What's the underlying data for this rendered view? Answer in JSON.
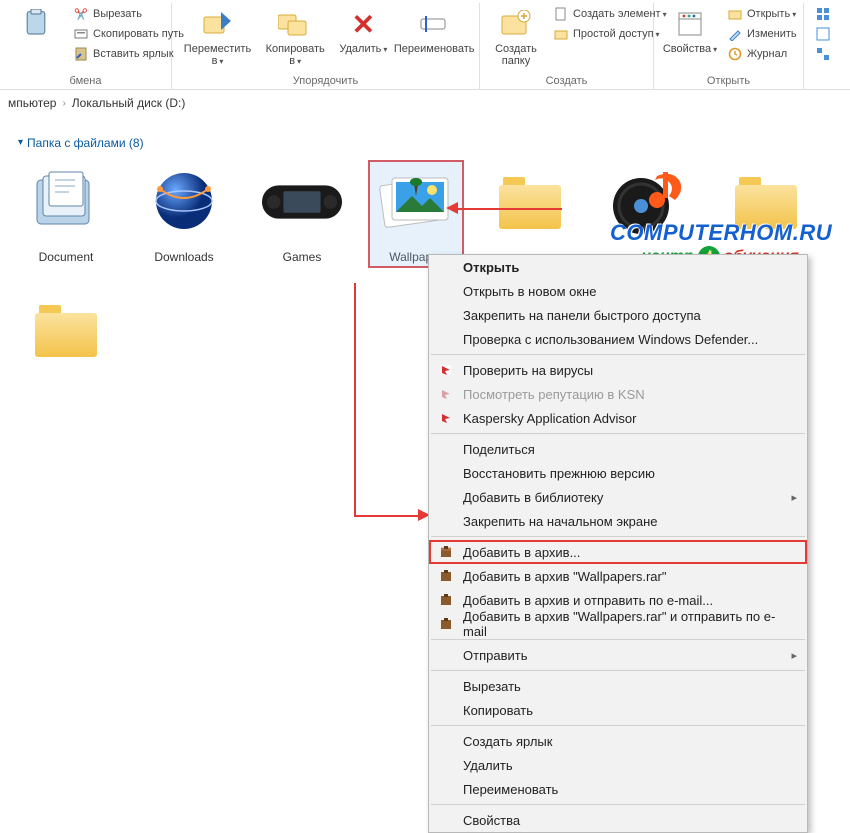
{
  "ribbon": {
    "group_clipboard": {
      "pin": "",
      "cut": "Вырезать",
      "copy_path": "Скопировать путь",
      "paste_shortcut": "Вставить ярлык",
      "label": "бмена"
    },
    "group_organize": {
      "move_to": "Переместить в",
      "copy_to": "Копировать в",
      "delete": "Удалить",
      "rename": "Переименовать",
      "label": "Упорядочить"
    },
    "group_create": {
      "new_folder": "Создать папку",
      "new_item": "Создать элемент",
      "easy_access": "Простой доступ",
      "label": "Создать"
    },
    "group_open": {
      "properties": "Свойства",
      "open": "Открыть",
      "edit": "Изменить",
      "history": "Журнал",
      "label": "Открыть"
    }
  },
  "breadcrumb": {
    "a": "мпьютер",
    "b": "Локальный диск (D:)"
  },
  "section": {
    "title": "Папка с файлами (8)"
  },
  "files": [
    {
      "name": "Document"
    },
    {
      "name": "Downloads"
    },
    {
      "name": "Games"
    },
    {
      "name": "Wallpaper"
    },
    {
      "name": ""
    },
    {
      "name": ""
    },
    {
      "name": ""
    },
    {
      "name": ""
    }
  ],
  "ctx": {
    "open": "Открыть",
    "open_new": "Открыть в новом окне",
    "pin_quick": "Закрепить на панели быстрого доступа",
    "defender": "Проверка с использованием Windows Defender...",
    "k_scan": "Проверить на вирусы",
    "k_ksn": "Посмотреть репутацию в KSN",
    "k_advisor": "Kaspersky Application Advisor",
    "share": "Поделиться",
    "restore": "Восстановить прежнюю версию",
    "library": "Добавить в библиотеку",
    "pin_start": "Закрепить на начальном экране",
    "rar_add": "Добавить в архив...",
    "rar_add_named": "Добавить в архив \"Wallpapers.rar\"",
    "rar_email": "Добавить в архив и отправить по e-mail...",
    "rar_named_email": "Добавить в архив \"Wallpapers.rar\" и отправить по e-mail",
    "send_to": "Отправить",
    "cut": "Вырезать",
    "copy": "Копировать",
    "shortcut": "Создать ярлык",
    "delete": "Удалить",
    "rename": "Переименовать",
    "props": "Свойства"
  },
  "watermark": {
    "l1": "COMPUTERHOM.RU",
    "l2a": "центр",
    "l2b": "обучения"
  }
}
